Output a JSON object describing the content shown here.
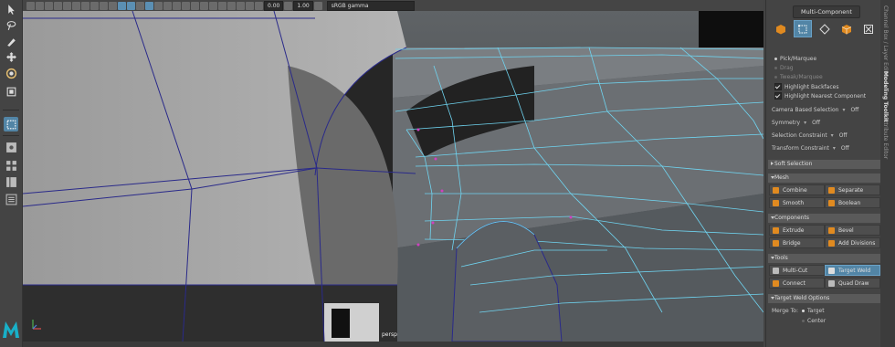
{
  "viewport": {
    "camera_label": "persp",
    "toolbar": {
      "field_a": "0.00",
      "field_b": "1.00",
      "color_space": "sRGB gamma"
    }
  },
  "panel": {
    "title": "Multi-Component",
    "pick_options": [
      "Pick/Marquee",
      "Drag",
      "Tweak/Marquee"
    ],
    "checkboxes": [
      "Highlight Backfaces",
      "Highlight Nearest Component"
    ],
    "settings": [
      {
        "label": "Camera Based Selection",
        "value": "Off"
      },
      {
        "label": "Symmetry",
        "value": "Off"
      },
      {
        "label": "Selection Constraint",
        "value": "Off"
      },
      {
        "label": "Transform Constraint",
        "value": "Off"
      }
    ],
    "soft_selection": "Soft Selection",
    "mesh": {
      "header": "Mesh",
      "buttons": [
        "Combine",
        "Separate",
        "Smooth",
        "Boolean"
      ]
    },
    "components": {
      "header": "Components",
      "buttons": [
        "Extrude",
        "Bevel",
        "Bridge",
        "Add Divisions"
      ]
    },
    "tools": {
      "header": "Tools",
      "buttons": [
        "Multi-Cut",
        "Target Weld",
        "Connect",
        "Quad Draw"
      ]
    },
    "target_weld": {
      "header": "Target Weld Options",
      "merge_to": "Merge To:",
      "options": [
        "Target",
        "Center"
      ]
    }
  },
  "side_tabs": [
    "Channel Box / Layer Editor",
    "Modeling Toolkit",
    "Attribute Editor"
  ],
  "colors": {
    "accent": "#5285a6",
    "wire": "#6fd4f0",
    "edge_dark": "#2a2a8a"
  }
}
